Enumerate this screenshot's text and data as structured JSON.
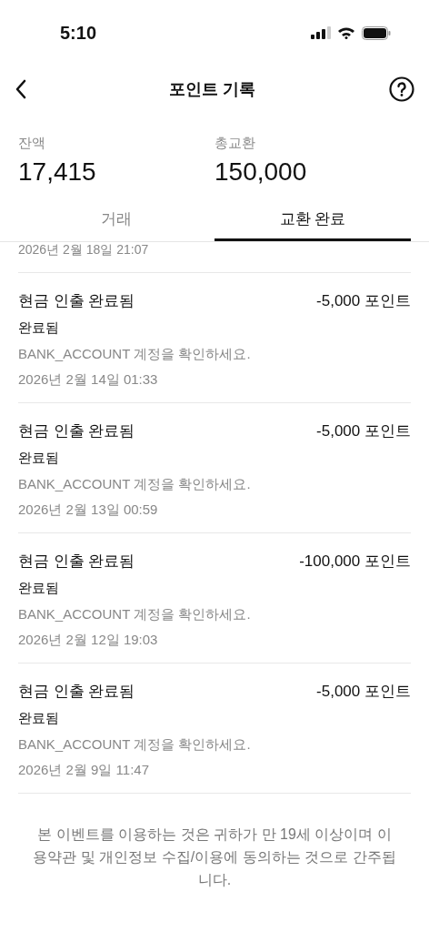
{
  "status_bar": {
    "time": "5:10"
  },
  "header": {
    "title": "포인트 기록"
  },
  "stats": [
    {
      "label": "잔액",
      "value": "17,415"
    },
    {
      "label": "총교환",
      "value": "150,000"
    }
  ],
  "tabs": [
    {
      "label": "거래",
      "selected": false
    },
    {
      "label": "교환 완료",
      "selected": true
    }
  ],
  "partial_row": {
    "date": "2026년 2월 18일 21:07"
  },
  "rows": [
    {
      "title": "현금 인출 완료됨",
      "amount": "-5,000 포인트",
      "status": "완료됨",
      "note": "BANK_ACCOUNT 계정을 확인하세요.",
      "date": "2026년 2월 14일 01:33"
    },
    {
      "title": "현금 인출 완료됨",
      "amount": "-5,000 포인트",
      "status": "완료됨",
      "note": "BANK_ACCOUNT 계정을 확인하세요.",
      "date": "2026년 2월 13일 00:59"
    },
    {
      "title": "현금 인출 완료됨",
      "amount": "-100,000 포인트",
      "status": "완료됨",
      "note": "BANK_ACCOUNT 계정을 확인하세요.",
      "date": "2026년 2월 12일 19:03"
    },
    {
      "title": "현금 인출 완료됨",
      "amount": "-5,000 포인트",
      "status": "완료됨",
      "note": "BANK_ACCOUNT 계정을 확인하세요.",
      "date": "2026년 2월 9일 11:47"
    }
  ],
  "footer": "본 이벤트를 이용하는 것은 귀하가 만 19세 이상이며 이용약관 및 개인정보 수집/이용에 동의하는 것으로 간주됩니다."
}
